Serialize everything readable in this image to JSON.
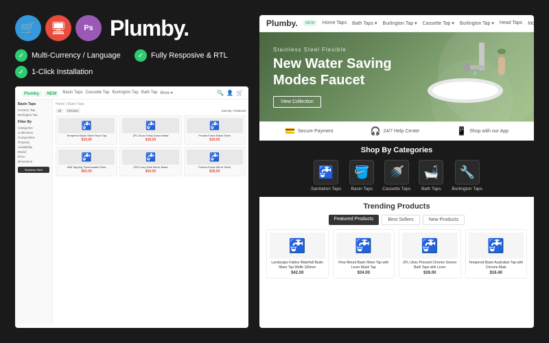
{
  "brand": {
    "name": "Plumby.",
    "badge": "NEW"
  },
  "features": {
    "item1": "Multi-Currency / Language",
    "item2": "Fully Resposive & RTL",
    "item3": "1-Click Installation"
  },
  "miniStore": {
    "logo": "Plumby.",
    "badge": "NEW",
    "navItems": [
      "Basin Taps",
      "Cassette Tap",
      "Burlington Tap",
      "Bath Tap",
      "More"
    ],
    "sidebarSections": [
      {
        "title": "Basin Taps",
        "items": [
          "Ceramic Tap",
          "Burlington Tap"
        ]
      },
      {
        "title": "Filter By",
        "items": [
          "Categories",
          "Collections",
          "Composition",
          "Property",
          "Availability",
          "Brand",
          "Price",
          "Dimension"
        ]
      },
      {
        "title": "Stainless Steel"
      }
    ],
    "products": [
      {
        "name": "Tempered Basin Mixer Rose Tap",
        "price": "$32.00"
      },
      {
        "name": "ZFL Uluru Fimily Gross Metal",
        "price": "$18.00"
      },
      {
        "name": "Protina Famic Basin Silver Chrome",
        "price": "$34.00"
      },
      {
        "name": "NIM Tapping Thermostatic Rose Wash Tap",
        "price": "$62.00"
      },
      {
        "name": "ZPA Curry Dark Mirror Basin Tap",
        "price": "$54.00"
      },
      {
        "name": "Protina Famic Mirror Silver Cross Tap",
        "price": "$28.00"
      }
    ]
  },
  "store": {
    "logo": "Plumby.",
    "badge": "NEW",
    "navItems": [
      "Home Taps",
      "Bath Taps",
      "Burlington Tap",
      "Cassette Tap",
      "Burlington Tap",
      "Head Taps",
      "More"
    ],
    "hero": {
      "subtitle": "Stainless Steel Flexible",
      "title1": "New Water Saving",
      "title2": "Modes Faucet",
      "btnLabel": "View Collection"
    },
    "featuresBar": [
      {
        "icon": "💳",
        "text": "Secure Payment"
      },
      {
        "icon": "🎧",
        "text": "24/7 Help Center"
      },
      {
        "icon": "📱",
        "text": "Shop with our App"
      }
    ],
    "categories": {
      "title": "Shop By Categories",
      "items": [
        {
          "icon": "🚰",
          "label": "Sanitation Taps"
        },
        {
          "icon": "🛁",
          "label": "Basin Taps"
        },
        {
          "icon": "🚿",
          "label": "Cassette Taps"
        },
        {
          "icon": "🛀",
          "label": "Bath Taps"
        },
        {
          "icon": "🔧",
          "label": "Burlington Taps"
        }
      ]
    },
    "trending": {
      "title": "Trending Products",
      "tabs": [
        "Featured Products",
        "Best Sellers",
        "New Products"
      ],
      "activeTab": "Featured Products",
      "products": [
        {
          "name": "Landscape Fables Waterfall Basin Mixer Tap Width 160mm",
          "price": "$42.00"
        },
        {
          "name": "Flow Mount Basin Mixer Tap with Lever Wash Tap",
          "price": "$34.00"
        },
        {
          "name": "ZFL Uluru Pressed Chrome Sensor Bath Taps with Lever",
          "price": "$28.00"
        },
        {
          "name": "Tempered Basin Australian Tap with Chrome Male",
          "price": "$16.40"
        }
      ]
    }
  }
}
